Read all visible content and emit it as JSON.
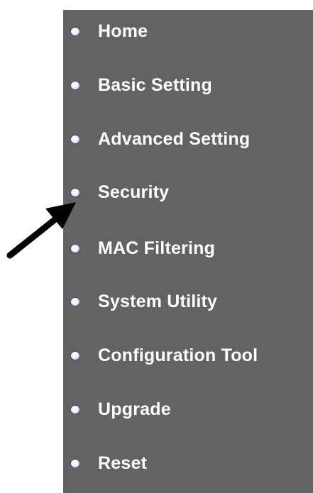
{
  "menu": {
    "items": [
      {
        "label": "Home",
        "icon": "bullet-icon"
      },
      {
        "label": "Basic Setting",
        "icon": "bullet-icon"
      },
      {
        "label": "Advanced Setting",
        "icon": "bullet-icon"
      },
      {
        "label": "Security",
        "icon": "bullet-icon"
      },
      {
        "label": "MAC Filtering",
        "icon": "bullet-icon"
      },
      {
        "label": "System Utility",
        "icon": "bullet-icon"
      },
      {
        "label": "Configuration Tool",
        "icon": "bullet-icon"
      },
      {
        "label": "Upgrade",
        "icon": "bullet-icon"
      },
      {
        "label": "Reset",
        "icon": "bullet-icon"
      }
    ]
  },
  "colors": {
    "panel_background": "#636363",
    "label_text": "#ffffff",
    "arrow": "#000000"
  },
  "pointer": {
    "icon": "arrow-icon",
    "points_to": "Security"
  }
}
